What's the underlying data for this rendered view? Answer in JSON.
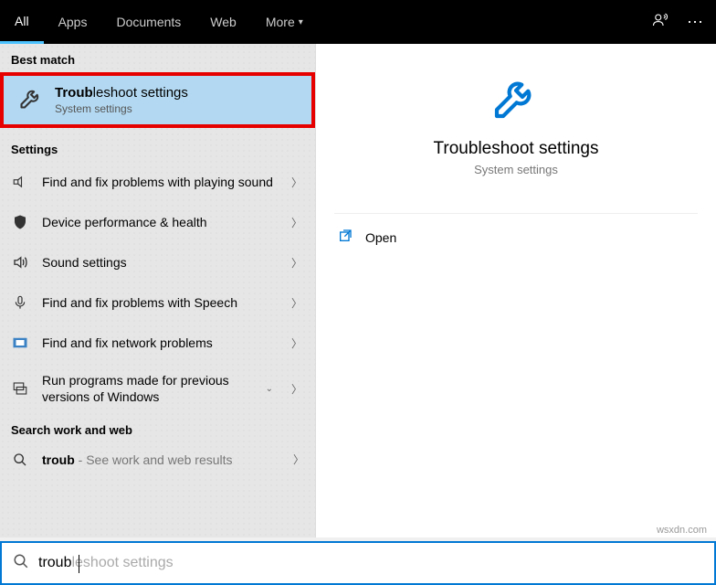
{
  "header": {
    "tabs": [
      "All",
      "Apps",
      "Documents",
      "Web",
      "More"
    ]
  },
  "sections": {
    "best_match": "Best match",
    "settings": "Settings",
    "search_web": "Search work and web"
  },
  "best_match": {
    "title_bold": "Troub",
    "title_rest": "leshoot settings",
    "subtitle": "System settings"
  },
  "settings_items": [
    {
      "label": "Find and fix problems with playing sound"
    },
    {
      "label": "Device performance & health"
    },
    {
      "label": "Sound settings"
    },
    {
      "label": "Find and fix problems with Speech"
    },
    {
      "label": "Find and fix network problems"
    },
    {
      "label": "Run programs made for previous versions of Windows"
    }
  ],
  "web_search": {
    "query_bold": "troub",
    "hint": " - See work and web results"
  },
  "preview": {
    "title": "Troubleshoot settings",
    "subtitle": "System settings",
    "open": "Open"
  },
  "search": {
    "typed": "troub",
    "suggest": "leshoot settings"
  },
  "watermark": "wsxdn.com"
}
